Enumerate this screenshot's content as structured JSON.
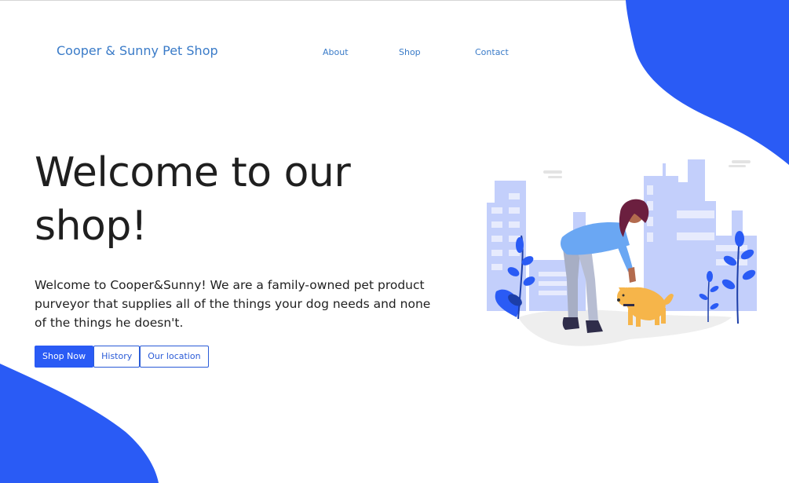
{
  "header": {
    "brand": "Cooper & Sunny Pet Shop",
    "nav": [
      {
        "label": "About"
      },
      {
        "label": "Shop"
      },
      {
        "label": "Contact"
      }
    ]
  },
  "hero": {
    "title": "Welcome to our shop!",
    "description": "Welcome to Cooper&Sunny! We are a family-owned pet product purveyor that supplies all of the things your dog needs and none of the things he doesn't.",
    "buttons": [
      {
        "label": "Shop Now"
      },
      {
        "label": "History"
      },
      {
        "label": "Our location"
      }
    ]
  },
  "colors": {
    "accent": "#2a5bf5",
    "link": "#3a7bc8",
    "buildings": "#c3cffb"
  },
  "illustration": {
    "icon": "woman-petting-dog-illustration"
  }
}
